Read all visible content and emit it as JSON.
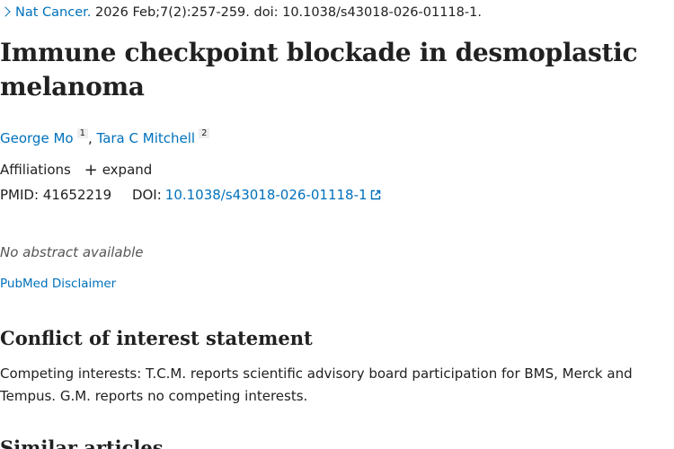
{
  "citation": {
    "journal": "Nat Cancer.",
    "details": "2026 Feb;7(2):257-259. doi: 10.1038/s43018-026-01118-1."
  },
  "article": {
    "title": "Immune checkpoint blockade in desmoplastic melanoma",
    "authors": [
      {
        "name": "George Mo",
        "affiliation_ref": "1"
      },
      {
        "name": "Tara C Mitchell",
        "affiliation_ref": "2"
      }
    ],
    "author_separator": ",",
    "affiliations_label": "Affiliations",
    "expand_label": "expand",
    "pmid_label": "PMID:",
    "pmid": "41652219",
    "doi_label": "DOI:",
    "doi": "10.1038/s43018-026-01118-1",
    "no_abstract": "No abstract available",
    "disclaimer": "PubMed Disclaimer"
  },
  "conflict_of_interest": {
    "heading": "Conflict of interest statement",
    "text": "Competing interests: T.C.M. reports scientific advisory board participation for BMS, Merck and Tempus. G.M. reports no competing interests."
  },
  "similar_articles": {
    "heading": "Similar articles"
  },
  "colors": {
    "link": "#0071bc",
    "text": "#212121",
    "muted": "#555555"
  },
  "icons": {
    "citation": "chevron-right-icon",
    "expand": "plus-icon",
    "doi": "external-link-icon"
  }
}
